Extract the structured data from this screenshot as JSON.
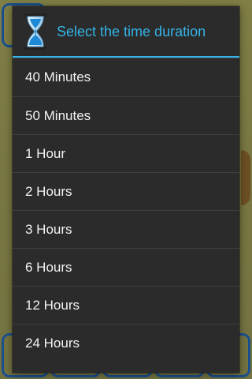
{
  "dialog": {
    "title": "Select the time duration",
    "icon": "hourglass-icon",
    "options": [
      "40 Minutes",
      "50 Minutes",
      "1 Hour",
      "2 Hours",
      "3 Hours",
      "6 Hours",
      "12 Hours",
      "24 Hours"
    ]
  },
  "colors": {
    "accent": "#34b4e6",
    "dialog_bg": "#2b2b2b",
    "app_bg": "#7b7a42"
  }
}
